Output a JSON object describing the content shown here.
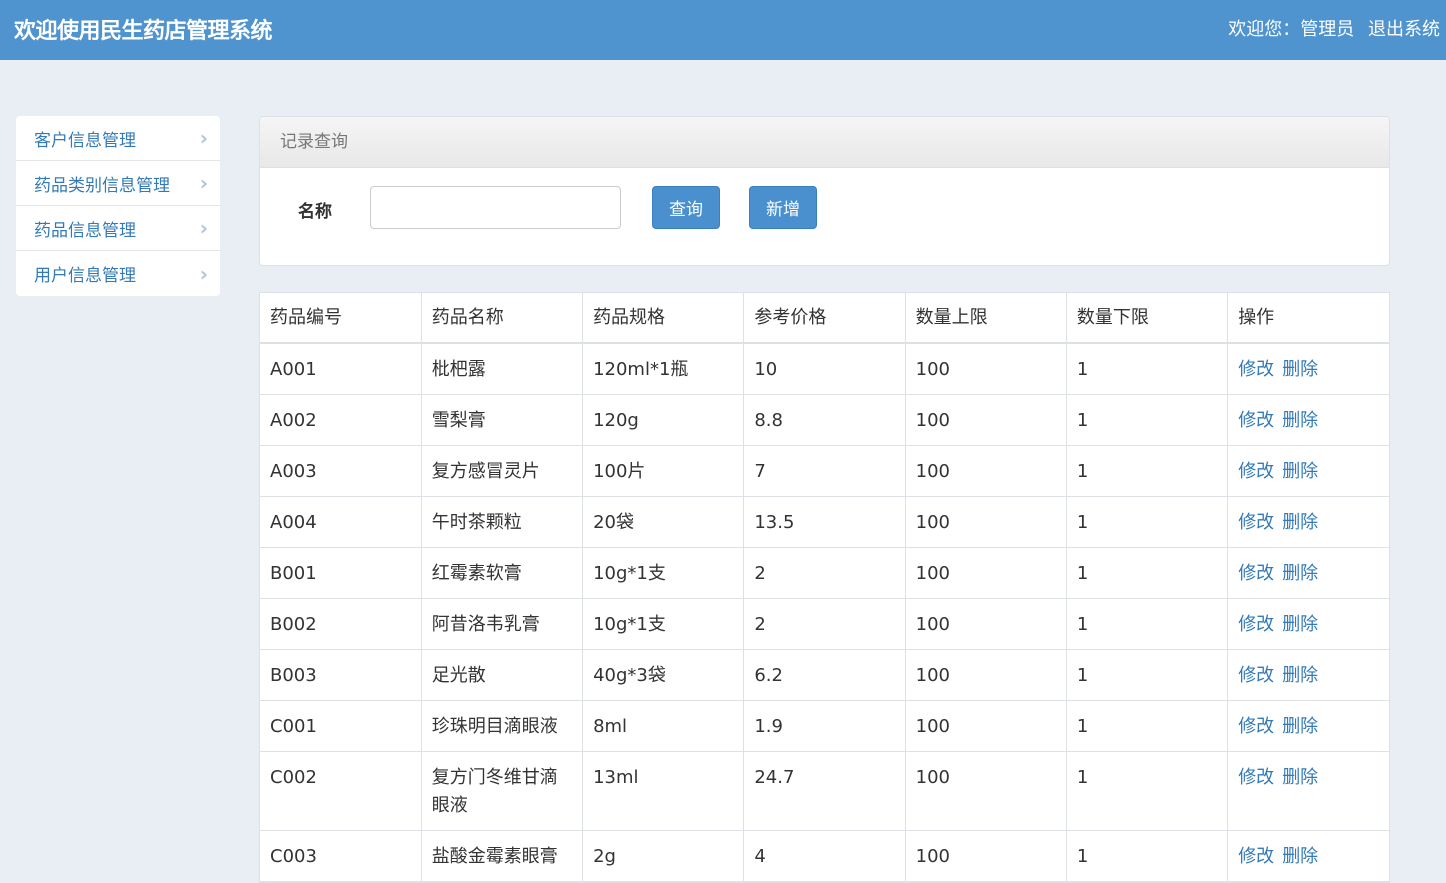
{
  "header": {
    "title": "欢迎使用民生药店管理系统",
    "welcome": "欢迎您：管理员",
    "logout": "退出系统"
  },
  "sidebar": {
    "items": [
      {
        "label": "客户信息管理"
      },
      {
        "label": "药品类别信息管理"
      },
      {
        "label": "药品信息管理"
      },
      {
        "label": "用户信息管理"
      }
    ]
  },
  "query": {
    "panel_title": "记录查询",
    "name_label": "名称",
    "name_value": "",
    "query_button": "查询",
    "add_button": "新增"
  },
  "table": {
    "columns": [
      "药品编号",
      "药品名称",
      "药品规格",
      "参考价格",
      "数量上限",
      "数量下限",
      "操作"
    ],
    "edit_label": "修改",
    "delete_label": "删除",
    "rows": [
      [
        "A001",
        "枇杷露",
        "120ml*1瓶",
        "10",
        "100",
        "1"
      ],
      [
        "A002",
        "雪梨膏",
        "120g",
        "8.8",
        "100",
        "1"
      ],
      [
        "A003",
        "复方感冒灵片",
        "100片",
        "7",
        "100",
        "1"
      ],
      [
        "A004",
        "午时茶颗粒",
        "20袋",
        "13.5",
        "100",
        "1"
      ],
      [
        "B001",
        "红霉素软膏",
        "10g*1支",
        "2",
        "100",
        "1"
      ],
      [
        "B002",
        "阿昔洛韦乳膏",
        "10g*1支",
        "2",
        "100",
        "1"
      ],
      [
        "B003",
        "足光散",
        "40g*3袋",
        "6.2",
        "100",
        "1"
      ],
      [
        "C001",
        "珍珠明目滴眼液",
        "8ml",
        "1.9",
        "100",
        "1"
      ],
      [
        "C002",
        "复方门冬维甘滴眼液",
        "13ml",
        "24.7",
        "100",
        "1"
      ],
      [
        "C003",
        "盐酸金霉素眼膏",
        "2g",
        "4",
        "100",
        "1"
      ]
    ]
  }
}
